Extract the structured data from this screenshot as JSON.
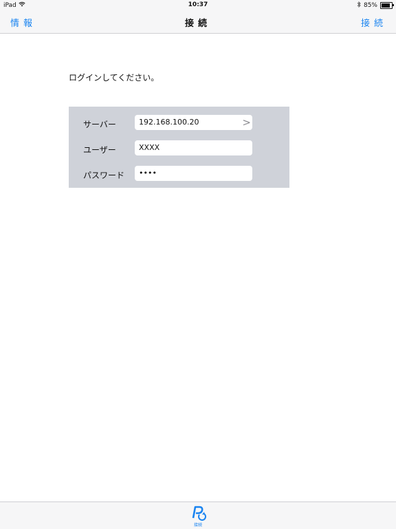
{
  "status_bar": {
    "device": "iPad",
    "time": "10:37",
    "battery_percent": "85%",
    "battery_level": 0.85,
    "icons": [
      "wifi-icon",
      "bluetooth-icon",
      "battery-icon"
    ]
  },
  "nav": {
    "left_label": "情報",
    "title": "接続",
    "right_label": "接続"
  },
  "content": {
    "prompt": "ログインしてください。",
    "fields": [
      {
        "label": "サーバー",
        "value": "192.168.100.20"
      },
      {
        "label": "ユーザー",
        "value": "XXXX"
      },
      {
        "label": "パスワード",
        "value": "••••"
      }
    ]
  },
  "tab_bar": {
    "items": [
      {
        "label": "接続",
        "icon": "connect-icon"
      }
    ]
  },
  "colors": {
    "accent": "#1a84f0",
    "panel": "#cfd2d9",
    "bar": "#f6f6f7"
  }
}
